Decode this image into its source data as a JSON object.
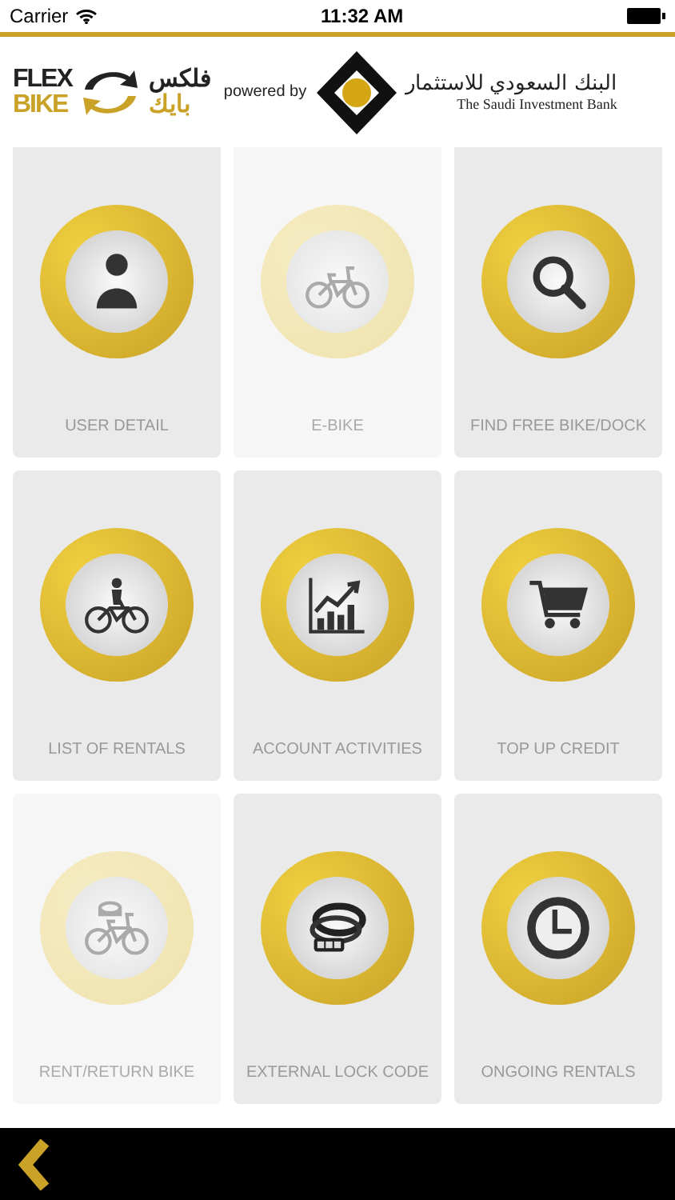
{
  "status_bar": {
    "carrier": "Carrier",
    "time": "11:32 AM"
  },
  "header": {
    "brand_line_1": "FLEX",
    "brand_line_2": "BIKE",
    "brand_arabic_1": "فلكس",
    "brand_arabic_2": "بايك",
    "powered_by": "powered by",
    "bank_arabic": "البنك السعودي للاستثمار",
    "bank_name": "The Saudi Investment Bank"
  },
  "tiles": [
    {
      "label": "USER DETAIL",
      "kind": "user",
      "disabled": false
    },
    {
      "label": "E-BIKE",
      "kind": "bike",
      "disabled": true
    },
    {
      "label": "FIND FREE BIKE/DOCK",
      "kind": "search",
      "disabled": false
    },
    {
      "label": "LIST OF RENTALS",
      "kind": "rider",
      "disabled": false
    },
    {
      "label": "ACCOUNT ACTIVITIES",
      "kind": "chart",
      "disabled": false
    },
    {
      "label": "TOP UP CREDIT",
      "kind": "cart",
      "disabled": false
    },
    {
      "label": "RENT/RETURN BIKE",
      "kind": "bikelock",
      "disabled": true
    },
    {
      "label": "EXTERNAL LOCK CODE",
      "kind": "lock",
      "disabled": false
    },
    {
      "label": "ONGOING RENTALS",
      "kind": "clock",
      "disabled": false
    }
  ]
}
